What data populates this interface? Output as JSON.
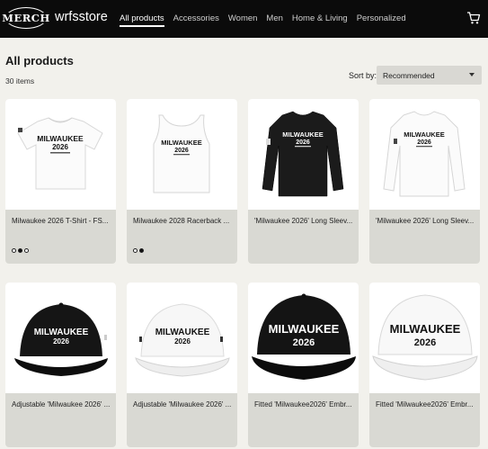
{
  "header": {
    "logo_text": "MERCH",
    "store_name": "wrfsstore",
    "nav": [
      "All products",
      "Accessories",
      "Women",
      "Men",
      "Home & Living",
      "Personalized"
    ],
    "active_nav": "All products",
    "cart_icon": "cart-icon"
  },
  "page": {
    "title": "All products",
    "count": "30 items",
    "sort_label": "Sort by:",
    "sort_value": "Recommended"
  },
  "products": [
    {
      "name": "Milwaukee 2026 T-Shirt - FS...",
      "print": "MILWAUKEE",
      "year": "2026",
      "image": "white-tshirt",
      "dots": 3,
      "active_dot": 2
    },
    {
      "name": "Milwaukee 2028 Racerback ...",
      "print": "MILWAUKEE",
      "year": "2026",
      "image": "white-tank",
      "dots": 2,
      "active_dot": 2
    },
    {
      "name": "'Milwaukee 2026' Long Sleev...",
      "print": "MILWAUKEE",
      "year": "2026",
      "image": "black-longsleeve"
    },
    {
      "name": "'Milwaukee 2026' Long Sleev...",
      "print": "MILWAUKEE",
      "year": "2026",
      "image": "white-longsleeve"
    },
    {
      "name": "Adjustable 'Milwaukee 2026' ...",
      "print": "MILWAUKEE",
      "year": "2026",
      "image": "black-cap"
    },
    {
      "name": "Adjustable 'Milwaukee 2026' ...",
      "print": "MILWAUKEE",
      "year": "2026",
      "image": "white-cap"
    },
    {
      "name": "Fitted 'Milwaukee2026' Embr...",
      "print": "MILWAUKEE",
      "year": "2026",
      "image": "black-fitted-cap"
    },
    {
      "name": "Fitted 'Milwaukee2026' Embr...",
      "print": "MILWAUKEE",
      "year": "2026",
      "image": "white-fitted-cap"
    }
  ],
  "colors": {
    "header_bg": "#0b0b0b",
    "page_bg": "#f2f1ec",
    "card_footer": "#d9d9d3"
  }
}
